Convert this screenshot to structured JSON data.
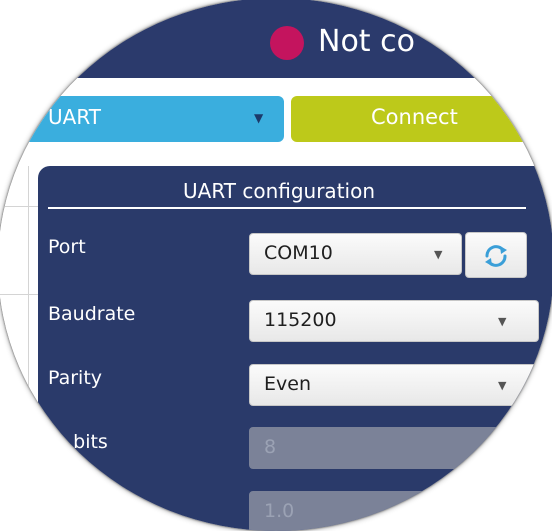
{
  "header": {
    "status_text": "Not co",
    "status_color": "#c4145e"
  },
  "toolbar": {
    "interface_value": "UART",
    "connect_label": "Connect"
  },
  "config": {
    "title": "UART configuration",
    "fields": [
      {
        "label": "Port",
        "value": "COM10"
      },
      {
        "label": "Baudrate",
        "value": "115200"
      },
      {
        "label": "Parity",
        "value": "Even"
      },
      {
        "label": "ta bits",
        "value": "8"
      },
      {
        "label": "",
        "value": "1.0"
      }
    ]
  },
  "colors": {
    "header_bg": "#2b3a6c",
    "interface_bg": "#3aaede",
    "connect_bg": "#bdc91a",
    "panel_bg": "#2a3a6a"
  },
  "icons": {
    "refresh": "refresh-icon"
  }
}
